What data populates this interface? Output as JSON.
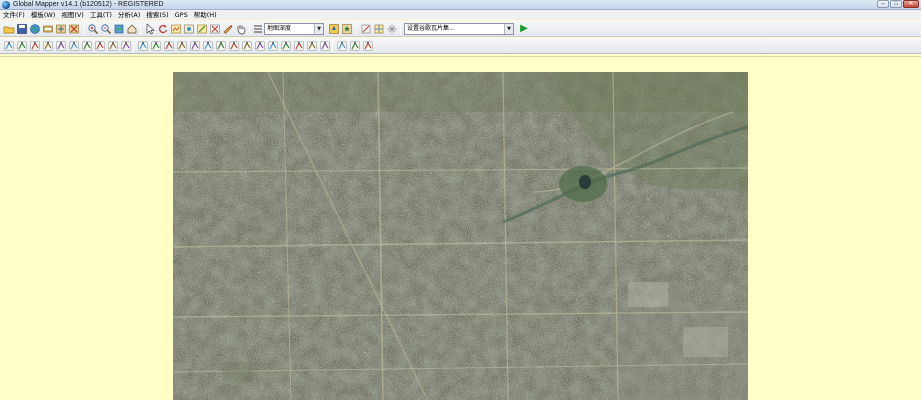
{
  "window": {
    "title": "Global Mapper v14.1 (b120512) - REGISTERED",
    "minimize_glyph": "–",
    "maximize_glyph": "□",
    "close_glyph": "✕"
  },
  "menu": [
    "文件(F)",
    "模板(W)",
    "视图(V)",
    "工具(T)",
    "分析(A)",
    "搜索(S)",
    "GPS",
    "帮助(H)"
  ],
  "toolbar1": {
    "buttons": [
      "open-folder-icon",
      "save-icon",
      "globe-icon",
      "print-icon",
      "export-icon",
      "close-layers-icon",
      "zoom-in-icon",
      "zoom-out-icon",
      "zoom-full-icon",
      "home-icon",
      "pointer-icon",
      "rotate-icon",
      "map-layout-icon",
      "layer-icon",
      "crop-icon",
      "vector-icon",
      "paint-icon",
      "hand-icon"
    ],
    "layer_combo": "地图深度",
    "layer_combo_icons": [
      "paint-bucket-icon",
      "star-tool-icon"
    ],
    "extra_buttons": [
      "overlay-icon",
      "grid-tool-icon",
      "sparkle-icon"
    ],
    "overlay_combo": "设置谷歌瓦片集...",
    "play_glyph": "▶"
  },
  "toolbar2": {
    "buttons": [
      "digitize-icon",
      "area-icon",
      "line-edit-icon",
      "line-split-icon",
      "line-join-icon",
      "line-select-icon",
      "vertex-add-icon",
      "vertex-del-icon",
      "vertex-move-icon",
      "feature-stack-icon",
      "measure-icon",
      "path-icon",
      "shape-edit-icon",
      "shape-ruler-icon",
      "shape-pen-icon",
      "shape-move-icon",
      "shape-cut-icon",
      "shape-rotate-icon",
      "shape-copy-icon",
      "shape-scale-icon",
      "shape-merge-icon",
      "shape-split-icon",
      "shape-fill-icon",
      "shape-outline-icon",
      "shape-delete-icon",
      "arc-icon",
      "curve-icon",
      "loop-icon"
    ]
  },
  "colors": {
    "workspace_bg": "#ffffc7",
    "toolbar_bg": "#eceef2",
    "accent_green": "#1a9b2a"
  }
}
